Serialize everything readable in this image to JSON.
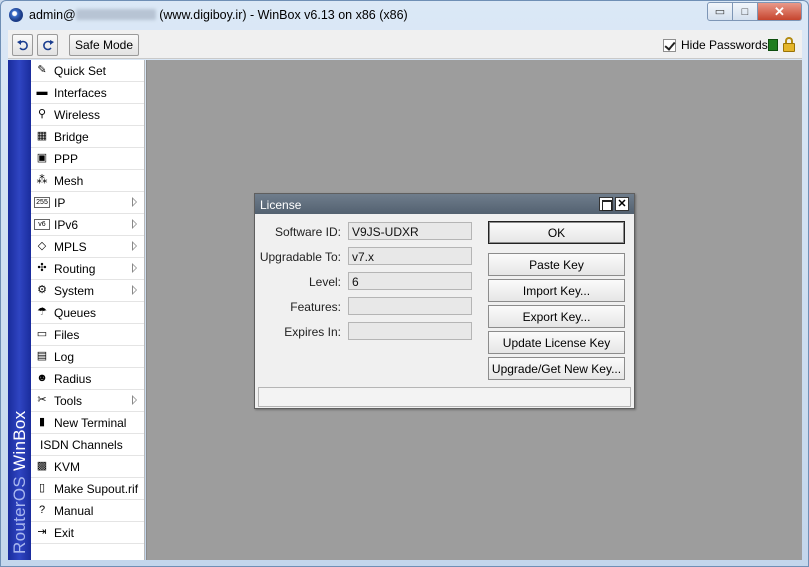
{
  "window": {
    "title_prefix": "admin@",
    "title_suffix": "(www.digiboy.ir) - WinBox v6.13 on x86 (x86)",
    "minimize_symbol": "▭",
    "maximize_symbol": "□",
    "close_symbol": "✕"
  },
  "toolbar": {
    "safe_mode_label": "Safe Mode",
    "hide_passwords_label": "Hide Passwords",
    "hide_passwords_checked": true
  },
  "brand": {
    "part1": "RouterOS",
    "part2": " WinBox"
  },
  "sidebar": {
    "items": [
      {
        "label": "Quick Set",
        "icon": "quick-set-icon",
        "glyph": "✎",
        "submenu": false
      },
      {
        "label": "Interfaces",
        "icon": "interfaces-icon",
        "glyph": "▬",
        "submenu": false
      },
      {
        "label": "Wireless",
        "icon": "wireless-icon",
        "glyph": "⚲",
        "submenu": false
      },
      {
        "label": "Bridge",
        "icon": "bridge-icon",
        "glyph": "▦",
        "submenu": false
      },
      {
        "label": "PPP",
        "icon": "ppp-icon",
        "glyph": "▣",
        "submenu": false
      },
      {
        "label": "Mesh",
        "icon": "mesh-icon",
        "glyph": "⁂",
        "submenu": false
      },
      {
        "label": "IP",
        "icon": "ip-icon",
        "glyph": "255",
        "submenu": true
      },
      {
        "label": "IPv6",
        "icon": "ipv6-icon",
        "glyph": "v6",
        "submenu": true
      },
      {
        "label": "MPLS",
        "icon": "mpls-icon",
        "glyph": "◇",
        "submenu": true
      },
      {
        "label": "Routing",
        "icon": "routing-icon",
        "glyph": "✣",
        "submenu": true
      },
      {
        "label": "System",
        "icon": "system-icon",
        "glyph": "⚙",
        "submenu": true
      },
      {
        "label": "Queues",
        "icon": "queues-icon",
        "glyph": "☂",
        "submenu": false
      },
      {
        "label": "Files",
        "icon": "files-icon",
        "glyph": "▭",
        "submenu": false
      },
      {
        "label": "Log",
        "icon": "log-icon",
        "glyph": "▤",
        "submenu": false
      },
      {
        "label": "Radius",
        "icon": "radius-icon",
        "glyph": "☻",
        "submenu": false
      },
      {
        "label": "Tools",
        "icon": "tools-icon",
        "glyph": "✂",
        "submenu": true
      },
      {
        "label": "New Terminal",
        "icon": "terminal-icon",
        "glyph": "▮",
        "submenu": false
      },
      {
        "label": "ISDN Channels",
        "icon": "",
        "glyph": "",
        "submenu": false
      },
      {
        "label": "KVM",
        "icon": "kvm-icon",
        "glyph": "▩",
        "submenu": false
      },
      {
        "label": "Make Supout.rif",
        "icon": "supout-icon",
        "glyph": "▯",
        "submenu": false
      },
      {
        "label": "Manual",
        "icon": "manual-icon",
        "glyph": "?",
        "submenu": false
      },
      {
        "label": "Exit",
        "icon": "exit-icon",
        "glyph": "⇥",
        "submenu": false
      }
    ]
  },
  "license_dialog": {
    "title": "License",
    "fields": [
      {
        "label": "Software ID:",
        "value": "V9JS-UDXR"
      },
      {
        "label": "Upgradable To:",
        "value": "v7.x"
      },
      {
        "label": "Level:",
        "value": "6"
      },
      {
        "label": "Features:",
        "value": ""
      },
      {
        "label": "Expires In:",
        "value": ""
      }
    ],
    "buttons": {
      "ok": "OK",
      "paste_key": "Paste Key",
      "import_key": "Import Key...",
      "export_key": "Export Key...",
      "update_license_key": "Update License Key",
      "upgrade_get_new_key": "Upgrade/Get New Key..."
    }
  },
  "colors": {
    "brand_bar": "#2f45c2",
    "workspace": "#9d9d9d",
    "dialog_titlebar": "#606e7e",
    "status_green": "#1f7d1f"
  }
}
